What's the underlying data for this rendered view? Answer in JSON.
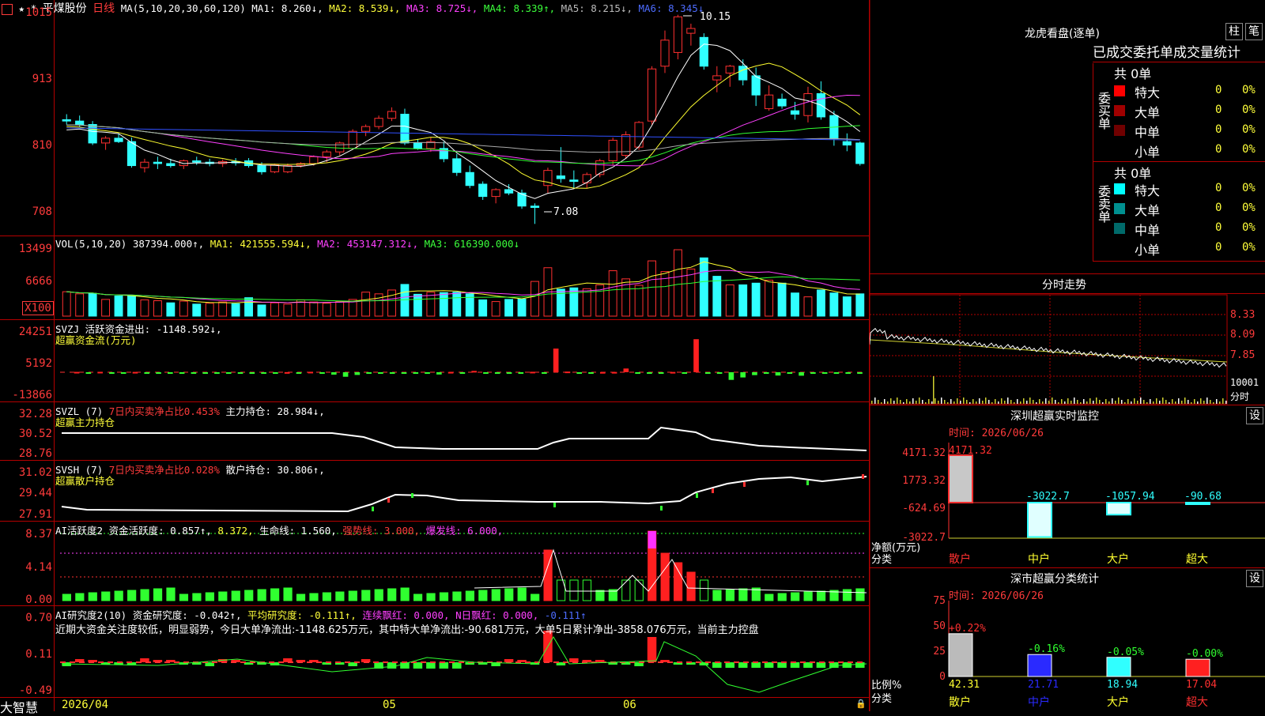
{
  "stock": {
    "flags": "★ *",
    "name": "平煤股份",
    "period": "日线"
  },
  "main_header": {
    "ma_params": "MA(5,10,20,30,60,120)",
    "ma1": "MA1: 8.260↓,",
    "ma2": "MA2: 8.539↓,",
    "ma3": "MA3: 8.725↓,",
    "ma4": "MA4: 8.339↑,",
    "ma5": "MA5: 8.215↓,",
    "ma6": "MA6: 8.345↓",
    "hi_label": "10.15",
    "lo_label": "7.08",
    "yticks": [
      "1015",
      "913",
      "810",
      "708"
    ]
  },
  "vol_header": {
    "name": "VOL(5,10,20)",
    "v": "387394.000↑,",
    "ma1": "MA1: 421555.594↓,",
    "ma2": "MA2: 453147.312↓,",
    "ma3": "MA3: 616390.000↓",
    "yticks": [
      "13499",
      "6666",
      "X100"
    ]
  },
  "svzj_header": {
    "name": "SVZJ",
    "l1": "活跃资金进出: -1148.592↓,",
    "l2": "超赢资金流(万元)",
    "yticks": [
      "24251",
      "5192",
      "-13866"
    ]
  },
  "svzl_header": {
    "name": "SVZL (7)",
    "p": "7日内买卖净占比0.453%",
    "hold": "主力持仓: 28.984↓,",
    "l2": "超赢主力持仓",
    "yticks": [
      "32.28",
      "30.52",
      "28.76"
    ]
  },
  "svsh_header": {
    "name": "SVSH (7)",
    "p": "7日内买卖净占比0.028%",
    "hold": "散户持仓: 30.806↑,",
    "l2": "超赢散户持仓",
    "yticks": [
      "31.02",
      "29.44",
      "27.91"
    ]
  },
  "ai1_header": {
    "name": "AI活跃度2",
    "a": "资金活跃度: 0.857↑,",
    "b": "8.372,",
    "c": "生命线: 1.560,",
    "d": "强势线: 3.000,",
    "e": "爆发线: 6.000,",
    "yticks": [
      "8.37",
      "4.14",
      "0.00"
    ]
  },
  "ai2_header": {
    "name": "AI研究度2(10)",
    "a": "资金研究度: -0.042↑,",
    "b": "平均研究度: -0.111↑,",
    "c": "连续飘红: 0.000,",
    "d": "N日飘红: 0.000,",
    "e": "-0.111↑",
    "comment": "近期大资金关注度较低，明显弱势，今日大单净流出:-1148.625万元，其中特大单净流出:-90.681万元，大单5日累计净出-3858.076万元，当前主力控盘",
    "yticks": [
      "0.70",
      "0.11",
      "-0.49"
    ]
  },
  "xaxis": {
    "labels": [
      "2026/04",
      "05",
      "06"
    ]
  },
  "brand": "大智慧",
  "right_panel": {
    "lhb_title": "龙虎看盘(逐单)",
    "btn_zhu": "柱",
    "btn_bi": "笔",
    "tabs": [
      "已成交",
      "委托单",
      "成交量统计"
    ],
    "buy_label": "委买单",
    "sell_label": "委卖单",
    "buy_total": "共 0单",
    "sell_total": "共 0单",
    "buy_rows": [
      {
        "label": "特大",
        "n": "0",
        "p": "0%",
        "color": "#ff0000"
      },
      {
        "label": "大单",
        "n": "0",
        "p": "0%",
        "color": "#a00000"
      },
      {
        "label": "中单",
        "n": "0",
        "p": "0%",
        "color": "#700000"
      },
      {
        "label": "小单",
        "n": "0",
        "p": "0%",
        "color": ""
      }
    ],
    "sell_rows": [
      {
        "label": "特大",
        "n": "0",
        "p": "0%",
        "color": "#00ffff"
      },
      {
        "label": "大单",
        "n": "0",
        "p": "0%",
        "color": "#009090"
      },
      {
        "label": "中单",
        "n": "0",
        "p": "0%",
        "color": "#006a6a"
      },
      {
        "label": "小单",
        "n": "0",
        "p": "0%",
        "color": ""
      }
    ],
    "fenshi_title": "分时走势",
    "fenshi_yticks": [
      "8.33",
      "8.09",
      "7.85",
      "10001",
      "分时"
    ],
    "monitor_title": "深圳超赢实时监控",
    "monitor_btn": "设",
    "monitor_date": "时间: 2026/06/26",
    "monitor_yticks": [
      "4171.32",
      "1773.32",
      "-624.69",
      "-3022.7"
    ],
    "monitor_ylabel": "净额(万元)",
    "monitor_xlabel": "分类",
    "monitor_bars": [
      {
        "cat": "散户",
        "value": 4171.32,
        "label": "4171.32"
      },
      {
        "cat": "中户",
        "value": -3022.7,
        "label": "-3022.7"
      },
      {
        "cat": "大户",
        "value": -1057.94,
        "label": "-1057.94"
      },
      {
        "cat": "超大",
        "value": -90.68,
        "label": "-90.68"
      }
    ],
    "stat_title": "深市超赢分类统计",
    "stat_btn": "设",
    "stat_date": "时间: 2026/06/26",
    "stat_yticks": [
      "75",
      "50",
      "25",
      "0"
    ],
    "stat_ylabel": "比例%",
    "stat_xlabel": "分类",
    "stat_bars": [
      {
        "cat": "散户",
        "value": 42.31,
        "chg": "+0.22%",
        "color": "#bbbbbb"
      },
      {
        "cat": "中户",
        "value": 21.71,
        "chg": "-0.16%",
        "color": "#2a2aff"
      },
      {
        "cat": "大户",
        "value": 18.94,
        "chg": "-0.05%",
        "color": "#30ffff"
      },
      {
        "cat": "超大",
        "value": 17.04,
        "chg": "-0.00%",
        "color": "#ff2020"
      }
    ]
  },
  "chart_data": [
    {
      "type": "candlestick",
      "title": "平煤股份 日线",
      "ylim": [
        7.0,
        10.25
      ],
      "ohlc": [
        [
          8.62,
          8.7,
          8.55,
          8.6
        ],
        [
          8.6,
          8.68,
          8.52,
          8.55
        ],
        [
          8.55,
          8.6,
          8.25,
          8.28
        ],
        [
          8.28,
          8.38,
          8.18,
          8.35
        ],
        [
          8.35,
          8.42,
          8.28,
          8.3
        ],
        [
          8.3,
          8.36,
          7.92,
          7.95
        ],
        [
          7.92,
          8.05,
          7.85,
          8.0
        ],
        [
          8.0,
          8.08,
          7.9,
          7.98
        ],
        [
          7.98,
          8.05,
          7.92,
          7.95
        ],
        [
          7.95,
          8.04,
          7.9,
          8.02
        ],
        [
          8.02,
          8.08,
          7.96,
          8.0
        ],
        [
          8.0,
          8.05,
          7.94,
          7.98
        ],
        [
          7.98,
          8.04,
          7.93,
          8.01
        ],
        [
          8.01,
          8.06,
          7.95,
          7.99
        ],
        [
          8.02,
          8.06,
          7.92,
          7.95
        ],
        [
          7.95,
          8.0,
          7.82,
          7.86
        ],
        [
          7.86,
          7.98,
          7.84,
          7.96
        ],
        [
          7.86,
          7.98,
          7.84,
          7.95
        ],
        [
          7.95,
          8.0,
          7.92,
          7.98
        ],
        [
          7.98,
          8.1,
          7.95,
          8.08
        ],
        [
          8.08,
          8.18,
          8.0,
          8.15
        ],
        [
          8.15,
          8.3,
          8.1,
          8.28
        ],
        [
          8.2,
          8.48,
          8.18,
          8.45
        ],
        [
          8.45,
          8.55,
          8.38,
          8.52
        ],
        [
          8.52,
          8.68,
          8.48,
          8.64
        ],
        [
          8.64,
          8.8,
          8.6,
          8.74
        ],
        [
          8.7,
          8.78,
          8.25,
          8.28
        ],
        [
          8.28,
          8.34,
          8.18,
          8.2
        ],
        [
          8.2,
          8.36,
          8.15,
          8.3
        ],
        [
          8.2,
          8.3,
          8.0,
          8.05
        ],
        [
          8.05,
          8.12,
          7.8,
          7.85
        ],
        [
          7.85,
          7.95,
          7.62,
          7.66
        ],
        [
          7.68,
          7.72,
          7.45,
          7.5
        ],
        [
          7.5,
          7.62,
          7.4,
          7.6
        ],
        [
          7.6,
          7.68,
          7.52,
          7.55
        ],
        [
          7.55,
          7.6,
          7.32,
          7.36
        ],
        [
          7.36,
          7.4,
          7.1,
          7.34
        ],
        [
          7.66,
          7.92,
          7.55,
          7.88
        ],
        [
          7.8,
          8.22,
          7.7,
          7.76
        ],
        [
          7.74,
          7.88,
          7.62,
          7.72
        ],
        [
          7.7,
          7.85,
          7.62,
          7.82
        ],
        [
          7.82,
          8.05,
          7.78,
          8.02
        ],
        [
          8.02,
          8.36,
          7.95,
          8.32
        ],
        [
          8.1,
          8.45,
          8.05,
          8.4
        ],
        [
          8.22,
          8.6,
          8.18,
          8.58
        ],
        [
          8.6,
          9.4,
          8.55,
          9.36
        ],
        [
          9.4,
          9.92,
          9.3,
          9.78
        ],
        [
          9.6,
          10.15,
          9.5,
          10.12
        ],
        [
          9.88,
          10.02,
          9.7,
          9.95
        ],
        [
          9.82,
          9.88,
          9.35,
          9.4
        ],
        [
          9.2,
          9.4,
          9.02,
          9.26
        ],
        [
          9.3,
          9.42,
          9.1,
          9.4
        ],
        [
          9.4,
          9.5,
          9.12,
          9.2
        ],
        [
          9.26,
          9.38,
          8.82,
          8.98
        ],
        [
          8.78,
          9.12,
          8.75,
          8.98
        ],
        [
          8.92,
          9.0,
          8.78,
          8.82
        ],
        [
          8.75,
          8.88,
          8.62,
          8.7
        ],
        [
          8.68,
          9.1,
          8.58,
          9.0
        ],
        [
          9.0,
          9.18,
          8.62,
          8.66
        ],
        [
          8.68,
          8.75,
          8.24,
          8.34
        ],
        [
          8.3,
          8.42,
          8.16,
          8.25
        ],
        [
          8.28,
          8.3,
          7.95,
          7.98
        ]
      ]
    },
    {
      "type": "bar",
      "title": "VOL(5,10,20)",
      "values": [
        5700,
        5200,
        5300,
        3900,
        4700,
        4800,
        3800,
        3600,
        3100,
        3500,
        2800,
        3000,
        3300,
        2900,
        4300,
        2600,
        3100,
        2800,
        3800,
        3300,
        3000,
        3400,
        3900,
        5600,
        5200,
        6100,
        7400,
        5100,
        5600,
        5500,
        5600,
        5200,
        3800,
        3400,
        3900,
        4000,
        8100,
        11300,
        6300,
        6600,
        6400,
        7300,
        10600,
        8700,
        7200,
        12900,
        10400,
        15500,
        11000,
        13600,
        9300,
        7300,
        7300,
        7700,
        8400,
        7700,
        5400,
        4500,
        6100,
        5400,
        4500,
        5200
      ],
      "up": [
        1,
        1,
        0,
        1,
        0,
        0,
        1,
        1,
        0,
        1,
        0,
        1,
        1,
        0,
        0,
        0,
        1,
        1,
        1,
        1,
        1,
        1,
        1,
        1,
        1,
        1,
        0,
        0,
        1,
        0,
        0,
        0,
        0,
        1,
        0,
        0,
        1,
        1,
        0,
        0,
        1,
        1,
        1,
        1,
        1,
        1,
        1,
        1,
        1,
        0,
        0,
        1,
        0,
        0,
        1,
        0,
        0,
        1,
        0,
        0,
        0,
        0
      ]
    },
    {
      "type": "bar",
      "title": "SVZJ",
      "values": [
        0,
        100,
        -150,
        120,
        -100,
        -80,
        90,
        -140,
        -80,
        -160,
        -60,
        -40,
        -40,
        -40,
        -120,
        -180,
        -40,
        -10,
        -50,
        30,
        -40,
        130,
        -420,
        -700,
        -1300,
        -780,
        -300,
        -220,
        -200,
        -50,
        -150,
        -180,
        -650,
        90,
        -60,
        380,
        -80,
        -120,
        -80,
        -90,
        130,
        -80,
        6800,
        190,
        -80,
        -50,
        60,
        80,
        1070,
        -90,
        -200,
        -260,
        80,
        -50,
        9500,
        -300,
        -200,
        -2200,
        -1500,
        -830,
        -140,
        -950,
        -80,
        -1000,
        -200,
        -50,
        -90,
        -80,
        -60
      ]
    }
  ]
}
